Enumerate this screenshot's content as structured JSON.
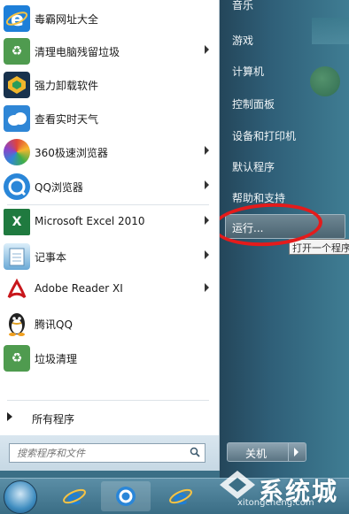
{
  "left_programs": [
    {
      "name": "毒霸网址大全",
      "icon": "ie-icon",
      "color": "#1e7fd8",
      "has_arrow": false
    },
    {
      "name": "清理电脑残留垃圾",
      "icon": "recycle-icon",
      "color": "#4f9b4f",
      "has_arrow": true
    },
    {
      "name": "强力卸载软件",
      "icon": "uninstall-icon",
      "color": "#18324d",
      "has_arrow": false
    },
    {
      "name": "查看实时天气",
      "icon": "cloud-icon",
      "color": "#2f86d6",
      "has_arrow": false
    },
    {
      "name": "360极速浏览器",
      "icon": "360-browser-icon",
      "color": "#e0453a",
      "has_arrow": true
    },
    {
      "name": "QQ浏览器",
      "icon": "qq-browser-icon",
      "color": "#2a86d8",
      "has_arrow": true
    },
    {
      "name": "Microsoft Excel 2010",
      "icon": "excel-icon",
      "color": "#1f7a3f",
      "has_arrow": true
    },
    {
      "name": "记事本",
      "icon": "notepad-icon",
      "color": "#6aa9d6",
      "has_arrow": true
    },
    {
      "name": "Adobe Reader XI",
      "icon": "pdf-icon",
      "color": "#c8171c",
      "has_arrow": true
    },
    {
      "name": "腾讯QQ",
      "icon": "qq-penguin-icon",
      "color": "#222222",
      "has_arrow": false
    },
    {
      "name": "垃圾清理",
      "icon": "recycle-icon",
      "color": "#4f9b4f",
      "has_arrow": false
    }
  ],
  "all_programs": "所有程序",
  "search": {
    "placeholder": "搜索程序和文件"
  },
  "right_items": [
    {
      "label": "音乐"
    },
    {
      "label": "游戏"
    },
    {
      "label": "计算机"
    },
    {
      "label": "控制面板"
    },
    {
      "label": "设备和打印机"
    },
    {
      "label": "默认程序"
    },
    {
      "label": "帮助和支持"
    }
  ],
  "run": {
    "label": "运行...",
    "tooltip": "打开一个程序"
  },
  "shutdown": {
    "label": "关机"
  },
  "watermark": {
    "text": "系统城",
    "url": "xitongcheng.com"
  },
  "colors": {
    "accent": "#3b6f86",
    "highlight_circle": "#e41b1b"
  }
}
